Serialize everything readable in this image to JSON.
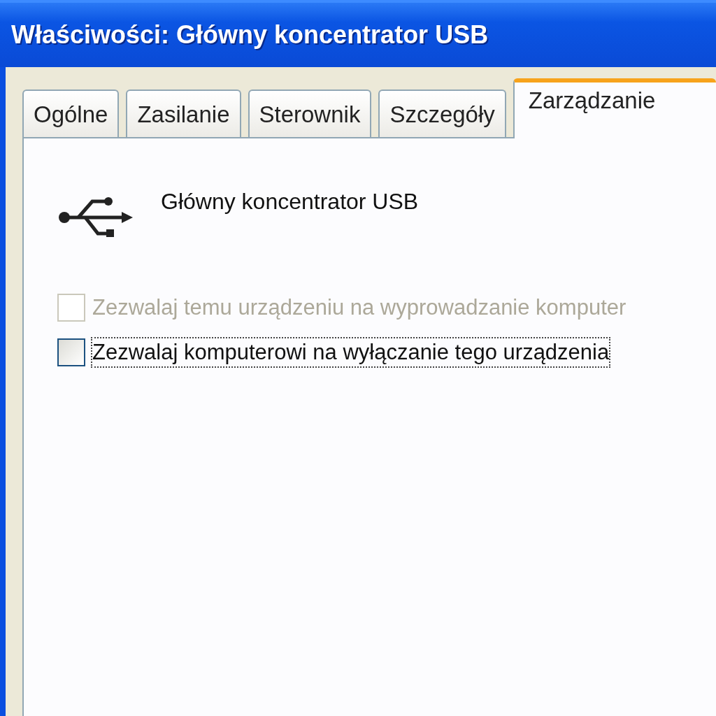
{
  "window": {
    "title": "Właściwości: Główny koncentrator USB"
  },
  "tabs": [
    {
      "label": "Ogólne",
      "selected": false
    },
    {
      "label": "Zasilanie",
      "selected": false
    },
    {
      "label": "Sterownik",
      "selected": false
    },
    {
      "label": "Szczegóły",
      "selected": false
    },
    {
      "label": "Zarządzanie",
      "selected": true
    }
  ],
  "device": {
    "name": "Główny koncentrator USB"
  },
  "options": [
    {
      "label": "Zezwalaj temu urządzeniu na wyprowadzanie komputer",
      "checked": false,
      "disabled": true,
      "focused": false
    },
    {
      "label": "Zezwalaj komputerowi na wyłączanie tego urządzenia",
      "checked": false,
      "disabled": false,
      "focused": true
    }
  ]
}
